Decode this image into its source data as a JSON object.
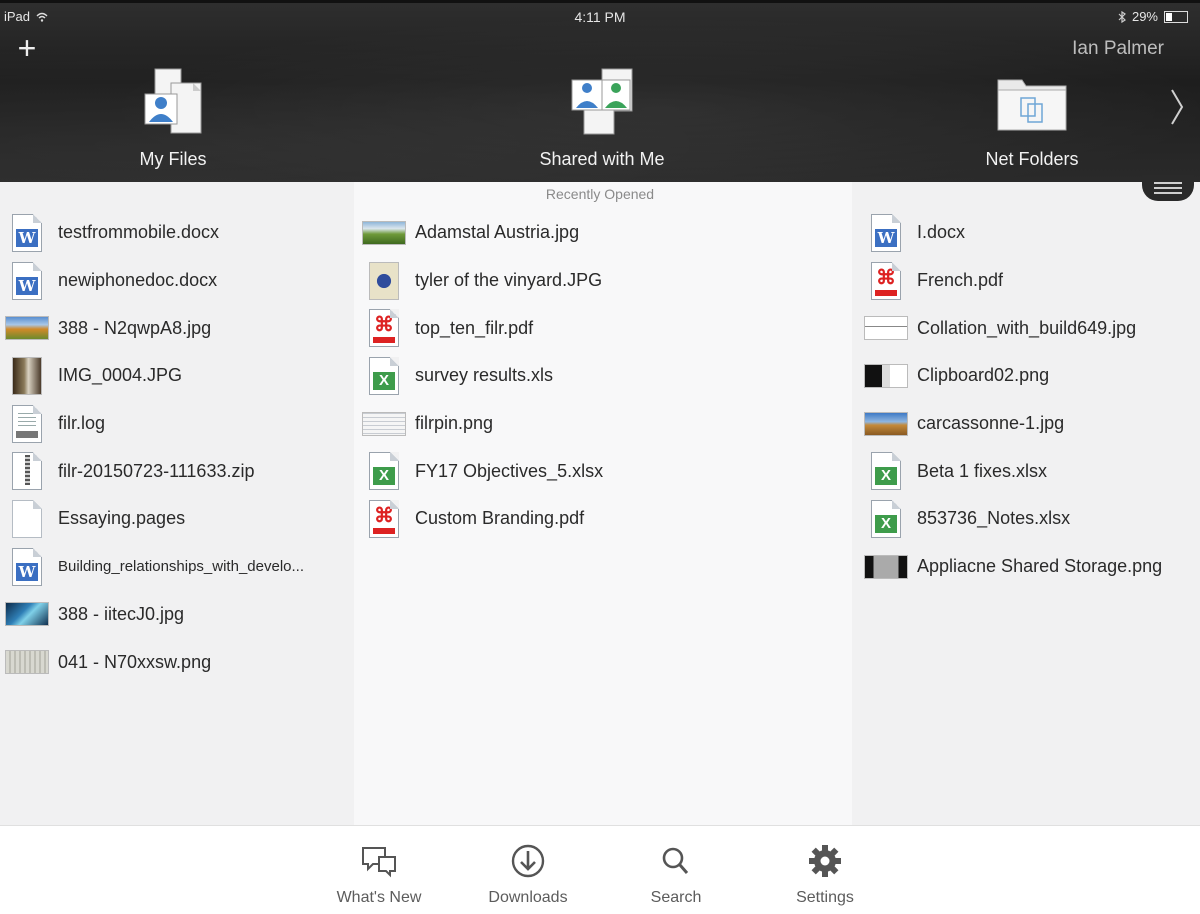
{
  "status_bar": {
    "device": "iPad",
    "time": "4:11 PM",
    "battery": "29%",
    "battery_level": 0.29
  },
  "header": {
    "user": "Ian Palmer",
    "nav": [
      {
        "label": "My Files",
        "icon": "my-files-icon"
      },
      {
        "label": "Shared with Me",
        "icon": "shared-with-me-icon"
      },
      {
        "label": "Net Folders",
        "icon": "net-folders-icon"
      }
    ]
  },
  "recent": {
    "title": "Recently Opened",
    "columns": [
      [
        {
          "name": "testfrommobile.docx",
          "type": "word"
        },
        {
          "name": "newiphonedoc.docx",
          "type": "word"
        },
        {
          "name": "388 - N2qwpA8.jpg",
          "type": "image"
        },
        {
          "name": "IMG_0004.JPG",
          "type": "image"
        },
        {
          "name": "filr.log",
          "type": "text"
        },
        {
          "name": "filr-20150723-111633.zip",
          "type": "zip"
        },
        {
          "name": "Essaying.pages",
          "type": "blank"
        },
        {
          "name": "Building_relationships_with_develo...",
          "type": "word"
        },
        {
          "name": "388 - iitecJ0.jpg",
          "type": "image"
        },
        {
          "name": "041 - N70xxsw.png",
          "type": "image"
        }
      ],
      [
        {
          "name": "Adamstal Austria.jpg",
          "type": "image"
        },
        {
          "name": "tyler of the vinyard.JPG",
          "type": "image"
        },
        {
          "name": "top_ten_filr.pdf",
          "type": "pdf"
        },
        {
          "name": "survey results.xls",
          "type": "excel"
        },
        {
          "name": "filrpin.png",
          "type": "image"
        },
        {
          "name": "FY17 Objectives_5.xlsx",
          "type": "excel"
        },
        {
          "name": "Custom Branding.pdf",
          "type": "pdf"
        }
      ],
      [
        {
          "name": "I.docx",
          "type": "word"
        },
        {
          "name": "French.pdf",
          "type": "pdf"
        },
        {
          "name": "Collation_with_build649.jpg",
          "type": "image"
        },
        {
          "name": "Clipboard02.png",
          "type": "image"
        },
        {
          "name": "carcassonne-1.jpg",
          "type": "image"
        },
        {
          "name": "Beta 1 fixes.xlsx",
          "type": "excel"
        },
        {
          "name": "853736_Notes.xlsx",
          "type": "excel"
        },
        {
          "name": "Appliacne Shared Storage.png",
          "type": "image"
        }
      ]
    ]
  },
  "tabbar": [
    {
      "label": "What's New",
      "icon": "whats-new-icon"
    },
    {
      "label": "Downloads",
      "icon": "downloads-icon"
    },
    {
      "label": "Search",
      "icon": "search-icon"
    },
    {
      "label": "Settings",
      "icon": "settings-icon"
    }
  ],
  "colors": {
    "header_bg": "#222222",
    "word": "#3b6fc2",
    "excel": "#3e9c4b",
    "pdf": "#dd2222",
    "tab_icon": "#555555"
  }
}
